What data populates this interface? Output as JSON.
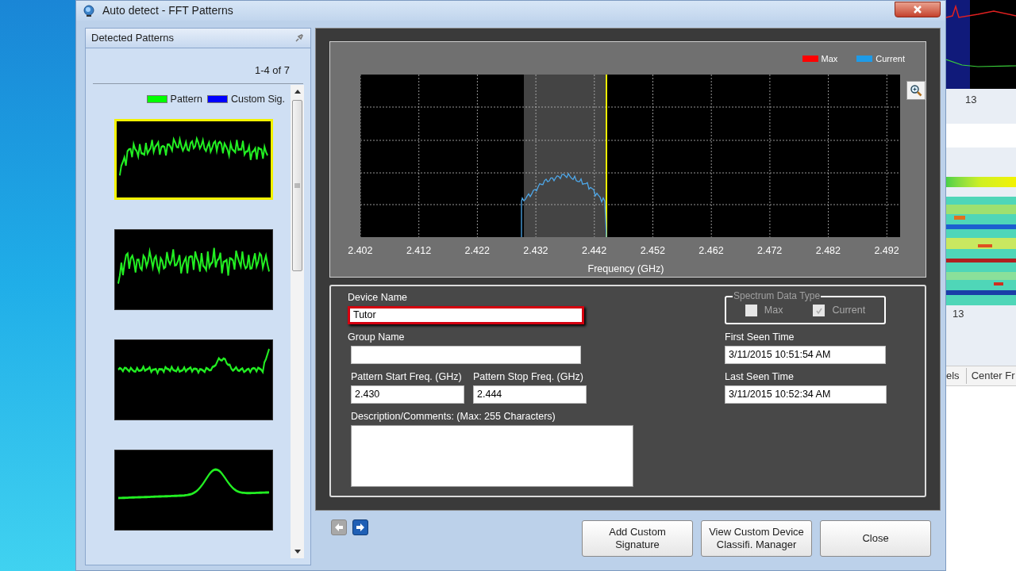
{
  "window": {
    "title": "Auto detect - FFT Patterns"
  },
  "patterns_panel": {
    "title": "Detected Patterns",
    "page_range": "1-4 of 7",
    "legend": [
      {
        "label": "Pattern",
        "color": "#00ff00"
      },
      {
        "label": "Custom Sig.",
        "color": "#0000ff"
      }
    ],
    "patterns": [
      {
        "kind": "noisy",
        "selected": true
      },
      {
        "kind": "jagged",
        "selected": false
      },
      {
        "kind": "ripple",
        "selected": false
      },
      {
        "kind": "peak",
        "selected": false
      }
    ]
  },
  "spectrum": {
    "legend": [
      {
        "label": "Max",
        "color": "#ff0000"
      },
      {
        "label": "Current",
        "color": "#1e9be8"
      }
    ],
    "x_tick_labels": [
      "2.402",
      "2.412",
      "2.422",
      "2.432",
      "2.442",
      "2.452",
      "2.462",
      "2.472",
      "2.482",
      "2.492"
    ],
    "xlabel": "Frequency (GHz)"
  },
  "form": {
    "device_name": {
      "label": "Device Name",
      "value": "Tutor",
      "highlighted": true
    },
    "group_name": {
      "label": "Group Name"
    },
    "start_freq": {
      "label": "Pattern Start Freq. (GHz)",
      "value": "2.430"
    },
    "stop_freq": {
      "label": "Pattern Stop Freq. (GHz)",
      "value": "2.444"
    },
    "description": {
      "label": "Description/Comments: (Max: 255 Characters)"
    },
    "spectrum_data_type": {
      "title": "Spectrum Data Type",
      "options": [
        {
          "label": "Max",
          "checked": false,
          "disabled": true
        },
        {
          "label": "Current",
          "checked": true,
          "disabled": true
        }
      ]
    },
    "first_seen": {
      "label": "First Seen Time",
      "value": "3/11/2015 10:51:54 AM"
    },
    "last_seen": {
      "label": "Last Seen Time",
      "value": "3/11/2015 10:52:34 AM"
    }
  },
  "navigation": [
    {
      "kind": "back",
      "disabled": true
    },
    {
      "kind": "forward",
      "disabled": false
    }
  ],
  "buttons": [
    "Add Custom\nSignature",
    "View Custom Device\nClassifi. Manager",
    "Close"
  ],
  "background_app": {
    "axis_labels": [
      "13",
      "13"
    ],
    "column_headers": [
      "els",
      "Center Fr"
    ]
  }
}
